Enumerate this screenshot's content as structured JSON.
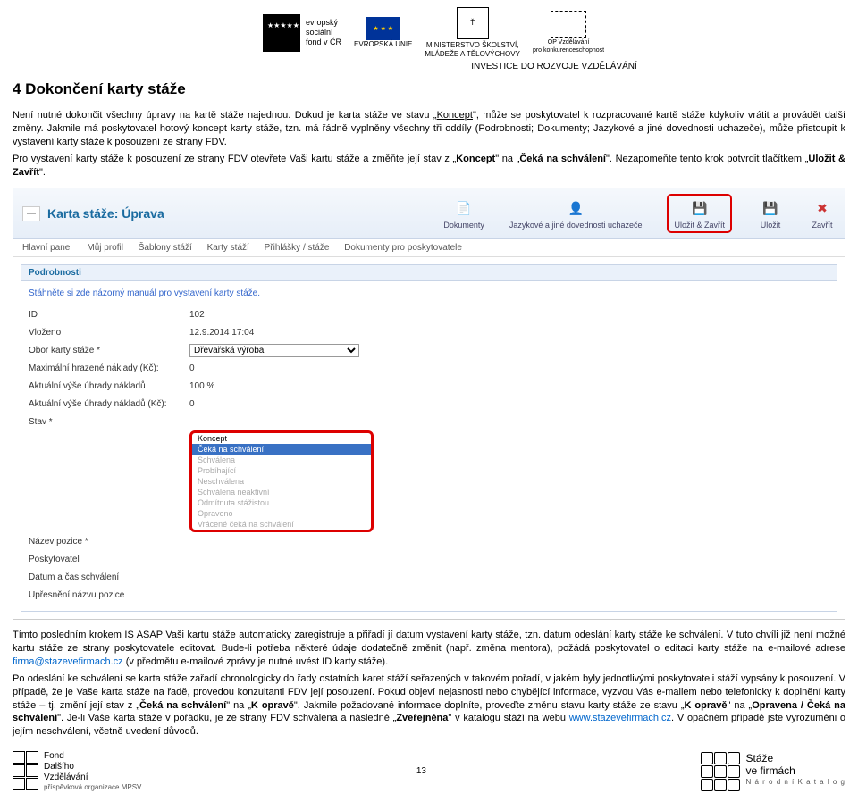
{
  "logos": {
    "esf_lines": "evropský\nsociální\nfond v ČR",
    "eu_label": "EVROPSKÁ UNIE",
    "ms_line1": "MINISTERSTVO ŠKOLSTVÍ,",
    "ms_line2": "MLÁDEŽE A TĚLOVÝCHOVY",
    "op_line1": "OP Vzdělávání",
    "op_line2": "pro konkurenceschopnost",
    "invest": "INVESTICE DO ROZVOJE VZDĚLÁVÁNÍ"
  },
  "heading": "4   Dokončení karty stáže",
  "p1a": "Není nutné dokončit všechny úpravy na kartě stáže najednou. Dokud je karta stáže ve stavu „",
  "p1_koncept": "Koncept",
  "p1b": "\", může se poskytovatel k rozpracované kartě stáže kdykoliv vrátit a provádět další změny. Jakmile má poskytovatel hotový koncept karty stáže, tzn. má řádně vyplněny všechny tři oddíly (Podrobnosti; Dokumenty; Jazykové a jiné dovednosti uchazeče), může přistoupit k vystavení karty stáže k posouzení ze strany FDV.",
  "p2a": "Pro vystavení karty stáže k posouzení ze strany FDV otevřete Vaši kartu stáže a změňte její stav z „",
  "p2_from": "Koncept",
  "p2b": "\" na „",
  "p2_to": "Čeká na schválení",
  "p2c": "\". Nezapomeňte tento krok potvrdit tlačítkem „",
  "p2_btn": "Uložit & Zavřít",
  "p2d": "\".",
  "ss": {
    "title": "Karta stáže: Úprava",
    "tb1": "Dokumenty",
    "tb2": "Jazykové a jiné dovednosti uchazeče",
    "tb3": "Uložit & Zavřít",
    "tb4": "Uložit",
    "tb5": "Zavřít",
    "nav": [
      "Hlavní panel",
      "Můj profil",
      "Šablony stáží",
      "Karty stáží",
      "Přihlášky / stáže",
      "Dokumenty pro poskytovatele"
    ],
    "panel": "Podrobnosti",
    "manual": "Stáhněte si zde názorný manuál pro vystavení karty stáže.",
    "rows": {
      "id_l": "ID",
      "id_v": "102",
      "vlozeno_l": "Vloženo",
      "vlozeno_v": "12.9.2014 17:04",
      "obor_l": "Obor karty stáže *",
      "obor_v": "Dřevařská výroba",
      "max_l": "Maximální hrazené náklady (Kč):",
      "max_v": "0",
      "uhrada_l": "Aktuální výše úhrady nákladů",
      "uhrada_v": "100 %",
      "nakl_l": "Aktuální výše úhrady nákladů (Kč):",
      "nakl_v": "0",
      "stav_l": "Stav *",
      "nazev_l": "Název pozice *",
      "posk_l": "Poskytovatel",
      "datum_l": "Datum a čas schválení",
      "upres_l": "Upřesnění názvu pozice"
    },
    "options": [
      "Koncept",
      "Čeká na schválení",
      "Schválena",
      "Probíhající",
      "Neschválena",
      "Schválena neaktivní",
      "Odmítnuta stážistou",
      "Opraveno",
      "Vrácené čeká na schválení"
    ]
  },
  "p3a": "Tímto posledním krokem IS ASAP Vaši kartu stáže automaticky zaregistruje a přiřadí jí datum vystavení karty stáže, tzn. datum odeslání karty stáže ke schválení. V tuto chvíli již není možné kartu stáže ze strany poskytovatele editovat. Bude-li potřeba některé údaje dodatečně změnit (např. změna mentora), požádá poskytovatel o editaci karty stáže na e-mailové adrese ",
  "email": "firma@stazevefirmach.cz",
  "p3b": " (v předmětu e-mailové zprávy je nutné uvést ID karty stáže).",
  "p4a": "Po odeslání ke schválení se karta stáže zařadí chronologicky do řady ostatních karet stáží seřazených v takovém pořadí, v jakém byly jednotlivými poskytovateli stáží vypsány k posouzení. V případě, že je Vaše karta stáže na řadě, provedou konzultanti FDV její posouzení. Pokud objeví nejasnosti nebo chybějící informace, vyzvou Vás e-mailem nebo telefonicky k doplnění karty stáže – tj. změní její stav z „",
  "p4_s1": "Čeká na schválení",
  "p4b": "\" na „",
  "p4_s2": "K opravě",
  "p4c": "\". Jakmile požadované informace doplníte, proveďte změnu stavu karty stáže ze stavu „",
  "p4_s3": "K opravě",
  "p4d": "\" na „",
  "p4_s4": "Opravena / Čeká na schválení",
  "p4e": "\". Je-li Vaše karta stáže v pořádku, je ze strany FDV schválena a následně „",
  "p4_s5": "Zveřejněna",
  "p4f": "\" v katalogu stáží na webu ",
  "url": "www.stazevefirmach.cz",
  "p4g": ". V opačném případě jste vyrozuměni o jejím neschválení, včetně uvedení důvodů.",
  "footer": {
    "fdv1": "Fond",
    "fdv2": "Dalšího",
    "fdv3": "Vzdělávání",
    "fdv_sub": "příspěvková organizace MPSV",
    "pageno": "13",
    "sf1": "Stáže",
    "sf2": "ve firmách",
    "sf_sub": "N á r o d n í   K a t a l o g"
  }
}
